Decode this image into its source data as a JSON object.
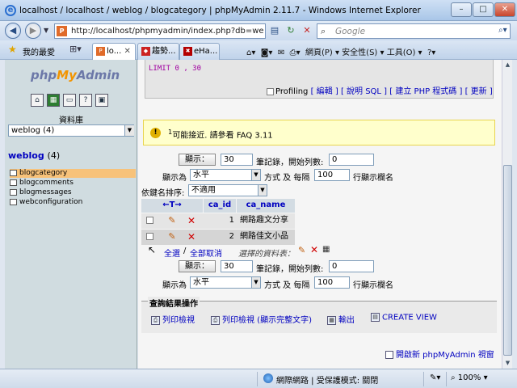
{
  "window": {
    "title": "localhost / localhost / weblog / blogcategory | phpMyAdmin 2.11.7 - Windows Internet Explorer",
    "min": "–",
    "max": "□",
    "close": "✕"
  },
  "address": {
    "url": "http://localhost/phpmyadmin/index.php?db=we",
    "search_placeholder": "Google"
  },
  "tabs": {
    "favorites_label": "我的最愛",
    "items": [
      {
        "label": "lo..."
      },
      {
        "label": "趨勢..."
      },
      {
        "label": "eHa..."
      }
    ],
    "tools": "網頁(P) ▾   安全性(S) ▾   工具(O) ▾"
  },
  "sidebar": {
    "logo": {
      "php": "php",
      "my": "My",
      "admin": "Admin"
    },
    "db_label": "資料庫",
    "db_selected": "weblog (4)",
    "db_heading": "weblog",
    "db_count": "(4)",
    "tables": [
      "blogcategory",
      "blogcomments",
      "blogmessages",
      "webconfiguration"
    ]
  },
  "main": {
    "sql_limit": "LIMIT 0 , 30",
    "profiling": "Profiling",
    "links": [
      "[ 編輯 ]",
      "[ 說明 SQL ]",
      "[ 建立 PHP 程式碼 ]",
      "[ 更新 ]"
    ],
    "notice_sup": "1",
    "notice": "可能接近. 請參看 FAQ 3.11",
    "nav_top": {
      "show_btn": "顯示：",
      "rows": "30",
      "start_label": "筆記錄，開始列數:",
      "start": "0",
      "mode_label": "顯示為",
      "mode": "水平",
      "repeat_label": "方式 及 每隔",
      "repeat": "100",
      "repeat_suffix": "行顯示欄名"
    },
    "sort_label": "依鍵名排序:",
    "sort_value": "不適用",
    "table": {
      "arrows": "←T→",
      "columns": [
        "ca_id",
        "ca_name"
      ],
      "rows": [
        {
          "ca_id": "1",
          "ca_name": "網路趣文分享"
        },
        {
          "ca_id": "2",
          "ca_name": "網路佳文小品"
        }
      ]
    },
    "select_all": "全選",
    "sep": "/",
    "deselect_all": "全部取消",
    "with_selected": "選擇的資料表：",
    "nav_bottom": {
      "show_btn": "顯示：",
      "rows": "30",
      "start_label": "筆記錄，開始列數:",
      "start": "0",
      "mode_label": "顯示為",
      "mode": "水平",
      "repeat_label": "方式 及 每隔",
      "repeat": "100",
      "repeat_suffix": "行顯示欄名"
    },
    "ops_title": "查詢結果操作",
    "ops": [
      "列印檢視",
      "列印檢視 (顯示完整文字)",
      "輸出",
      "CREATE VIEW"
    ],
    "new_window": "開啟新 phpMyAdmin 視窗"
  },
  "status": {
    "zone": "網際網路 | 受保護模式: 關閉",
    "zoom": "100%"
  }
}
